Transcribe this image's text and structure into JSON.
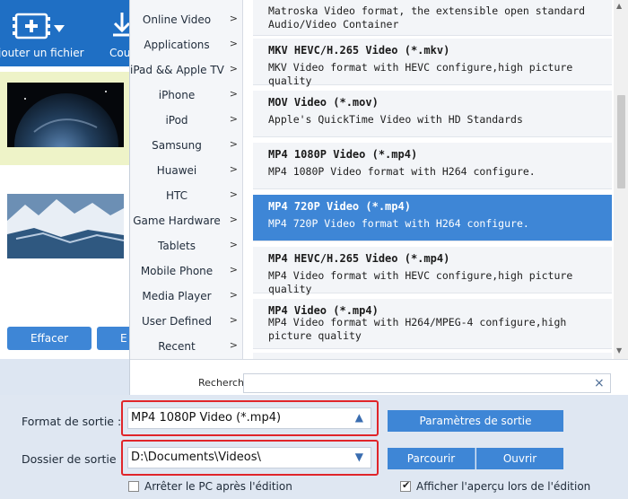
{
  "toolbar": {
    "add_file_label": "jouter un fichier",
    "convert_label": "Cou"
  },
  "left_buttons": {
    "clear_label": "Effacer",
    "edit_label": "E"
  },
  "categories": [
    {
      "label": "Online Video"
    },
    {
      "label": "Applications"
    },
    {
      "label": "iPad && Apple TV"
    },
    {
      "label": "iPhone"
    },
    {
      "label": "iPod"
    },
    {
      "label": "Samsung"
    },
    {
      "label": "Huawei"
    },
    {
      "label": "HTC"
    },
    {
      "label": "Game Hardware"
    },
    {
      "label": "Tablets"
    },
    {
      "label": "Mobile Phone"
    },
    {
      "label": "Media Player"
    },
    {
      "label": "User Defined"
    },
    {
      "label": "Recent"
    }
  ],
  "category_arrow": ">",
  "formats": [
    {
      "title": "",
      "desc": "Matroska Video format, the extensible open standard Audio/Video Container"
    },
    {
      "title": "MKV HEVC/H.265 Video (*.mkv)",
      "desc": "MKV Video format with HEVC configure,high picture quality"
    },
    {
      "title": "MOV Video (*.mov)",
      "desc": "Apple's QuickTime Video with HD Standards"
    },
    {
      "title": "MP4 1080P Video (*.mp4)",
      "desc": "MP4 1080P Video format with H264 configure."
    },
    {
      "title": "MP4 720P Video (*.mp4)",
      "desc": "MP4 720P Video format with H264 configure."
    },
    {
      "title": "MP4 HEVC/H.265 Video (*.mp4)",
      "desc": "MP4 Video format with HEVC configure,high picture quality"
    },
    {
      "title": "MP4 Video (*.mp4)",
      "desc": "MP4 Video format with H264/MPEG-4 configure,high picture quality"
    },
    {
      "title": "",
      "desc": ""
    }
  ],
  "selected_format_index": 4,
  "search": {
    "label": "Recherche",
    "value": "",
    "clear_icon": "×"
  },
  "output": {
    "format_label": "Format de sortie :",
    "format_value": "MP4 1080P Video (*.mp4)",
    "settings_button": "Paramètres de sortie",
    "folder_label": "Dossier de sortie :",
    "folder_value": "D:\\Documents\\Videos\\",
    "browse_button": "Parcourir",
    "open_button": "Ouvrir",
    "shutdown_label": "Arrêter le PC après l'édition",
    "shutdown_checked": false,
    "preview_label": "Afficher l'aperçu lors de l'édition",
    "preview_checked": true
  },
  "colors": {
    "accent": "#3e86d6",
    "toolbar": "#1f6fc4",
    "highlight_frame": "#e0252a",
    "selected_item_bg": "#eef3c8"
  },
  "icons": {
    "add_file": "film-add-icon",
    "dropdown": "chevron-down-icon",
    "convert": "convert-icon",
    "category_chevron": "chevron-right-icon",
    "select_arrow_up": "triangle-up-icon",
    "select_arrow_down": "triangle-down-icon"
  }
}
